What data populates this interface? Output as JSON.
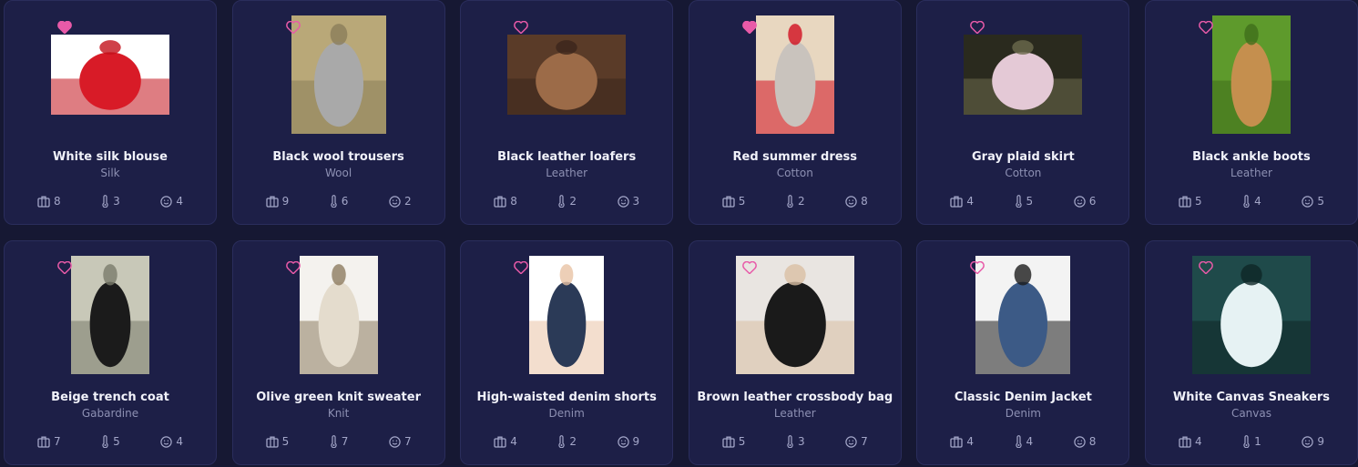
{
  "colors": {
    "background": "#161833",
    "card": "#1d1f47",
    "heart_pink": "#e85aa8",
    "text_muted": "#8d90b3"
  },
  "items": [
    {
      "name": "White silk blouse",
      "material": "Silk",
      "stats": {
        "wardrobe": "8",
        "temperature": "3",
        "mood": "4"
      },
      "favorited": true,
      "image": "woman-red-blouse",
      "img_colors": [
        "#ffffff",
        "#d81b27",
        "#c3121c"
      ]
    },
    {
      "name": "Black wool trousers",
      "material": "Wool",
      "stats": {
        "wardrobe": "9",
        "temperature": "6",
        "mood": "2"
      },
      "favorited": false,
      "image": "gray-sweatsuit-flatlay",
      "img_colors": [
        "#b9a878",
        "#a9a9a9",
        "#8b7d5a"
      ]
    },
    {
      "name": "Black leather loafers",
      "material": "Leather",
      "stats": {
        "wardrobe": "8",
        "temperature": "2",
        "mood": "3"
      },
      "favorited": false,
      "image": "market-shop-interior",
      "img_colors": [
        "#5a3b28",
        "#9c6b48",
        "#3b261c"
      ]
    },
    {
      "name": "Red summer dress",
      "material": "Cotton",
      "stats": {
        "wardrobe": "5",
        "temperature": "2",
        "mood": "8"
      },
      "favorited": true,
      "image": "woman-red-dress-road",
      "img_colors": [
        "#e8d7c0",
        "#c9c3bd",
        "#d10f1f"
      ]
    },
    {
      "name": "Gray plaid skirt",
      "material": "Cotton",
      "stats": {
        "wardrobe": "4",
        "temperature": "5",
        "mood": "6"
      },
      "favorited": false,
      "image": "woman-lying-flowers",
      "img_colors": [
        "#2a2a1e",
        "#e4c9d6",
        "#6b6a4c"
      ]
    },
    {
      "name": "Black ankle boots",
      "material": "Leather",
      "stats": {
        "wardrobe": "5",
        "temperature": "4",
        "mood": "5"
      },
      "favorited": false,
      "image": "tan-boots-grass",
      "img_colors": [
        "#5e9a2c",
        "#c58f4e",
        "#3f6e1c"
      ]
    },
    {
      "name": "Beige trench coat",
      "material": "Gabardine",
      "stats": {
        "wardrobe": "7",
        "temperature": "5",
        "mood": "4"
      },
      "favorited": false,
      "image": "woman-black-coat-hall",
      "img_colors": [
        "#c8c8b8",
        "#1b1b1b",
        "#7a7c6c"
      ]
    },
    {
      "name": "Olive green knit sweater",
      "material": "Knit",
      "stats": {
        "wardrobe": "5",
        "temperature": "7",
        "mood": "7"
      },
      "favorited": false,
      "image": "stacked-knit-sweaters",
      "img_colors": [
        "#f4f2ee",
        "#e4dccd",
        "#8d7c60"
      ]
    },
    {
      "name": "High-waisted denim shorts",
      "material": "Denim",
      "stats": {
        "wardrobe": "4",
        "temperature": "2",
        "mood": "9"
      },
      "favorited": false,
      "image": "denim-shorts-legs",
      "img_colors": [
        "#ffffff",
        "#2b3a57",
        "#e9c3a5"
      ]
    },
    {
      "name": "Brown leather crossbody bag",
      "material": "Leather",
      "stats": {
        "wardrobe": "5",
        "temperature": "3",
        "mood": "7"
      },
      "favorited": false,
      "image": "black-crossbody-bag",
      "img_colors": [
        "#e9e5e1",
        "#1a1a1a",
        "#d9bfa4"
      ]
    },
    {
      "name": "Classic Denim Jacket",
      "material": "Denim",
      "stats": {
        "wardrobe": "4",
        "temperature": "4",
        "mood": "8"
      },
      "favorited": false,
      "image": "man-denim-jacket",
      "img_colors": [
        "#f3f3f3",
        "#3c5a86",
        "#1b1b1b"
      ]
    },
    {
      "name": "White Canvas Sneakers",
      "material": "Canvas",
      "stats": {
        "wardrobe": "4",
        "temperature": "1",
        "mood": "9"
      },
      "favorited": false,
      "image": "sneakers-teal-background",
      "img_colors": [
        "#1f4a4a",
        "#e6f2f3",
        "#0e2626"
      ]
    }
  ]
}
